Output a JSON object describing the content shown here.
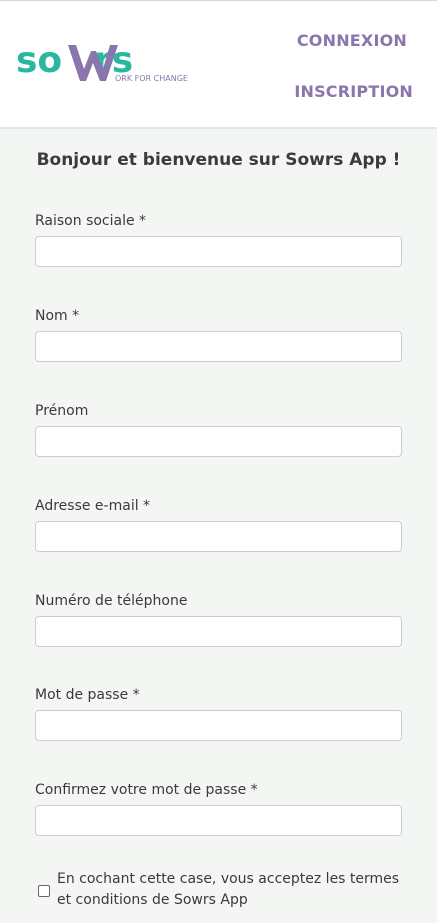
{
  "header": {
    "logo_text": "sowrs",
    "logo_tagline": "ORK FOR CHANGE",
    "nav": {
      "connexion": "CONNEXION",
      "inscription": "INSCRIPTION"
    }
  },
  "page": {
    "title": "Bonjour et bienvenue sur Sowrs App !"
  },
  "form": {
    "fields": [
      {
        "label": "Raison sociale *",
        "value": ""
      },
      {
        "label": "Nom *",
        "value": ""
      },
      {
        "label": "Prénom",
        "value": ""
      },
      {
        "label": "Adresse e-mail *",
        "value": ""
      },
      {
        "label": "Numéro de téléphone",
        "value": ""
      },
      {
        "label": "Mot de passe *",
        "value": ""
      },
      {
        "label": "Confirmez votre mot de passe *",
        "value": ""
      }
    ],
    "terms_label": "En cochant cette case, vous acceptez les termes et conditions de Sowrs App",
    "terms_checked": false
  },
  "colors": {
    "teal": "#2ab7a0",
    "purple": "#8a76ad",
    "background": "#f4f6f4"
  }
}
